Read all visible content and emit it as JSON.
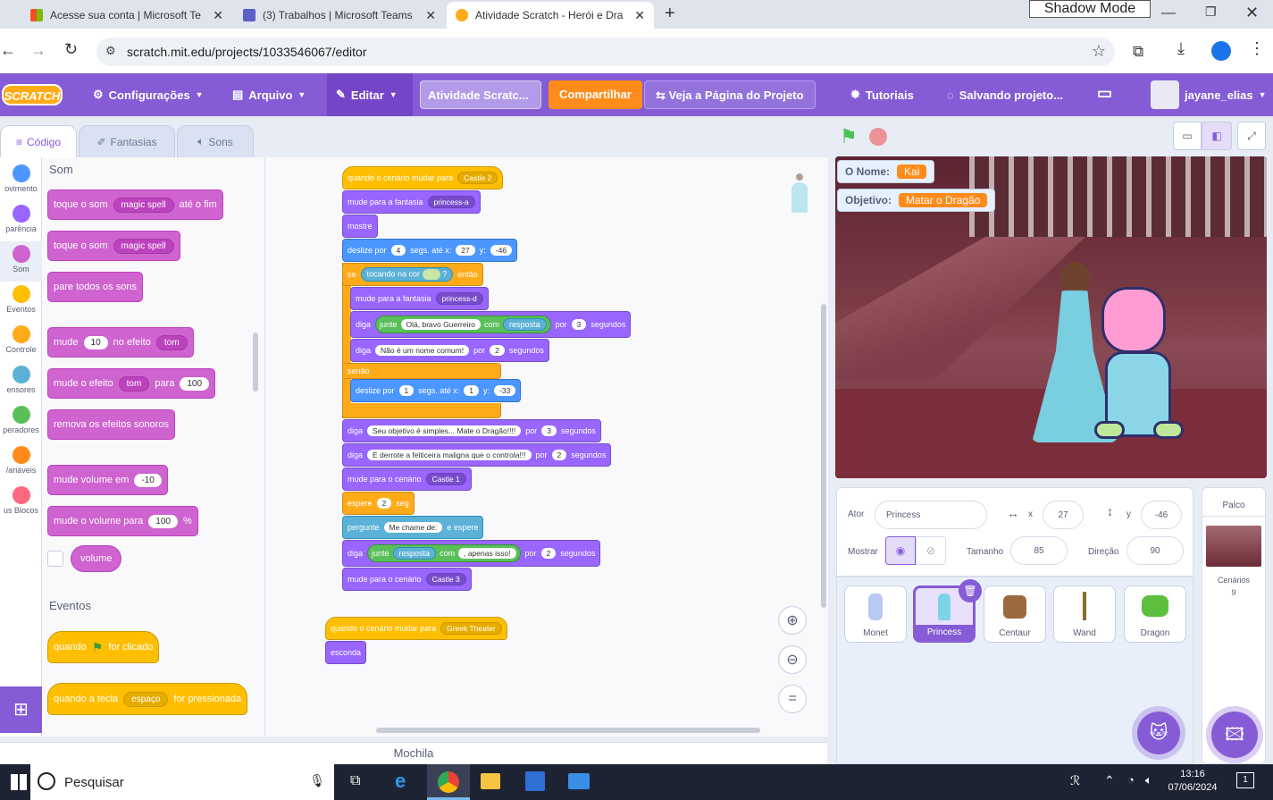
{
  "browser": {
    "tabs": [
      {
        "title": "Acesse sua conta | Microsoft Te"
      },
      {
        "title": "(3) Trabalhos | Microsoft Teams"
      },
      {
        "title": "Atividade Scratch - Herói e Dra"
      }
    ],
    "new_tab": "+",
    "shadow_mode": "Shadow Mode",
    "url": "scratch.mit.edu/projects/1033546067/editor"
  },
  "menu": {
    "logo": "SCRATCH",
    "settings": "Configurações",
    "file": "Arquivo",
    "edit": "Editar",
    "project_title": "Atividade Scratc...",
    "share": "Compartilhar",
    "see_page": "Veja a Página do Projeto",
    "tutorials": "Tutoriais",
    "saving": "Salvando projeto...",
    "username": "jayane_elias"
  },
  "editor_tabs": {
    "code": "Código",
    "costumes": "Fantasias",
    "sounds": "Sons"
  },
  "categories": [
    {
      "label": "ovimento",
      "color": "#4c97ff"
    },
    {
      "label": "parência",
      "color": "#9966ff"
    },
    {
      "label": "Som",
      "color": "#cf63cf"
    },
    {
      "label": "Eventos",
      "color": "#ffbf00"
    },
    {
      "label": "Controle",
      "color": "#ffab19"
    },
    {
      "label": "ensores",
      "color": "#5cb1d6"
    },
    {
      "label": "peradores",
      "color": "#59c059"
    },
    {
      "label": "/ariáveis",
      "color": "#ff8c1a"
    },
    {
      "label": "us Blocos",
      "color": "#ff6680"
    }
  ],
  "palette": {
    "sound_header": "Som",
    "b1": {
      "a": "toque o som",
      "snd": "magic spell",
      "b": "até o fim"
    },
    "b2": {
      "a": "toque o som",
      "snd": "magic spell"
    },
    "b3": "pare todos os sons",
    "b4": {
      "a": "mude",
      "v": "10",
      "b": "no efeito",
      "eff": "tom"
    },
    "b5": {
      "a": "mude o efeito",
      "eff": "tom",
      "b": "para",
      "v": "100"
    },
    "b6": "remova os efeitos sonoros",
    "b7": {
      "a": "mude volume em",
      "v": "-10"
    },
    "b8": {
      "a": "mude o volume para",
      "v": "100",
      "b": "%"
    },
    "b9": "volume",
    "events_header": "Eventos",
    "e1": {
      "a": "quando",
      "b": "for clicado"
    },
    "e2": {
      "a": "quando a tecla",
      "key": "espaço",
      "b": "for pressionada"
    }
  },
  "script1": {
    "hat": {
      "a": "quando o cenário mudar para",
      "v": "Castle 2"
    },
    "costume1": {
      "a": "mude para a fantasia",
      "v": "princess-a"
    },
    "show": "mostre",
    "glide1": {
      "a": "deslize por",
      "s": "4",
      "b": "segs. até x:",
      "x": "27",
      "c": "y:",
      "y": "-46"
    },
    "if": {
      "a": "se",
      "b": "tocando na cor",
      "q": "?",
      "c": "então"
    },
    "costume2": {
      "a": "mude para a fantasia",
      "v": "princess-d"
    },
    "say1": {
      "a": "diga",
      "j": "junte",
      "t": "Olá, bravo Guerreiro",
      "w": "com",
      "r": "resposta",
      "p": "por",
      "s": "3",
      "u": "segundos"
    },
    "say2": {
      "a": "diga",
      "t": "Não é um nome comum!",
      "p": "por",
      "s": "2",
      "u": "segundos"
    },
    "else": "senão",
    "glide2": {
      "a": "deslize por",
      "s": "1",
      "b": "segs. até x:",
      "x": "1",
      "c": "y:",
      "y": "-33"
    },
    "say3": {
      "a": "diga",
      "t": "Seu objetivo é simples... Mate o Dragão!!!!",
      "p": "por",
      "s": "3",
      "u": "segundos"
    },
    "say4": {
      "a": "diga",
      "t": "E derrote a feiticeira maligna que o controla!!!",
      "p": "por",
      "s": "2",
      "u": "segundos"
    },
    "backdrop1": {
      "a": "mude para o cenário",
      "v": "Castle 1"
    },
    "wait": {
      "a": "espere",
      "s": "2",
      "u": "seg"
    },
    "ask": {
      "a": "pergunte",
      "t": "Me chame de:",
      "b": "e espere"
    },
    "say5": {
      "a": "diga",
      "j": "junte",
      "r": "resposta",
      "w": "com",
      "t": ", apenas isso!",
      "p": "por",
      "s": "2",
      "u": "segundos"
    },
    "backdrop2": {
      "a": "mude para o cenário",
      "v": "Castle 3"
    }
  },
  "script2": {
    "hat": {
      "a": "quando o cenário mudar para",
      "v": "Greek Theater"
    },
    "hide": "esconda"
  },
  "backpack": "Mochila",
  "stage": {
    "monitor1": {
      "label": "O Nome:",
      "value": "Kai"
    },
    "monitor2": {
      "label": "Objetivo:",
      "value": "Matar o Dragão"
    }
  },
  "sprite_info": {
    "actor_label": "Ator",
    "actor": "Princess",
    "x_label": "x",
    "x": "27",
    "y_label": "y",
    "y": "-46",
    "show_label": "Mostrar",
    "size_label": "Tamanho",
    "size": "85",
    "dir_label": "Direção",
    "dir": "90"
  },
  "sprites": [
    "Monet",
    "Princess",
    "Centaur",
    "Wand",
    "Dragon"
  ],
  "palco": {
    "title": "Palco",
    "label": "Cenários",
    "count": "9"
  },
  "taskbar": {
    "search": "Pesquisar",
    "time": "13:16",
    "date": "07/06/2024",
    "notif": "1"
  }
}
